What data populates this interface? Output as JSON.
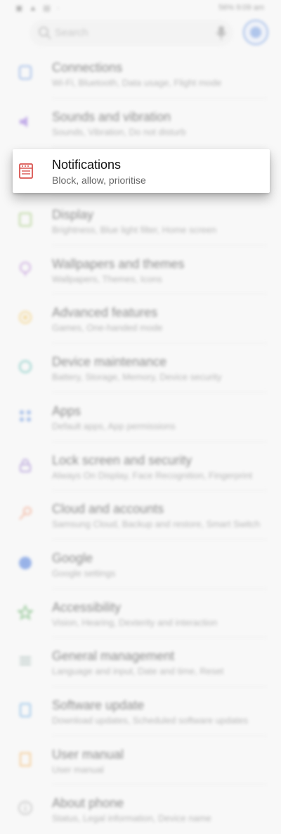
{
  "status_bar": {
    "left_icons": "▣ ▲ ▤ ·",
    "battery": "56%",
    "time": "9:09 am"
  },
  "search": {
    "placeholder": "Search"
  },
  "colors": {
    "accent": "#4a7fd8",
    "highlight_icon": "#d9534f"
  },
  "settings_items": [
    {
      "title": "Connections",
      "subtitle": "Wi-Fi, Bluetooth, Data usage, Flight mode",
      "icon": "connections-icon",
      "color": "#4a7fd8"
    },
    {
      "title": "Sounds and vibration",
      "subtitle": "Sounds, Vibration, Do not disturb",
      "icon": "sound-icon",
      "color": "#8b5fd8"
    },
    {
      "title": "Notifications",
      "subtitle": "Block, allow, prioritise",
      "icon": "notifications-icon",
      "color": "#d9534f"
    },
    {
      "title": "Display",
      "subtitle": "Brightness, Blue light filter, Home screen",
      "icon": "display-icon",
      "color": "#7cb342"
    },
    {
      "title": "Wallpapers and themes",
      "subtitle": "Wallpapers, Themes, Icons",
      "icon": "wallpaper-icon",
      "color": "#a05fc8"
    },
    {
      "title": "Advanced features",
      "subtitle": "Games, One-handed mode",
      "icon": "advanced-features-icon",
      "color": "#f0b429"
    },
    {
      "title": "Device maintenance",
      "subtitle": "Battery, Storage, Memory, Device security",
      "icon": "device-maintenance-icon",
      "color": "#26a69a"
    },
    {
      "title": "Apps",
      "subtitle": "Default apps, App permissions",
      "icon": "apps-icon",
      "color": "#4a7fd8"
    },
    {
      "title": "Lock screen and security",
      "subtitle": "Always On Display, Face Recognition, Fingerprint",
      "icon": "lock-icon",
      "color": "#7e57c2"
    },
    {
      "title": "Cloud and accounts",
      "subtitle": "Samsung Cloud, Backup and restore, Smart Switch",
      "icon": "cloud-key-icon",
      "color": "#ef7c52"
    },
    {
      "title": "Google",
      "subtitle": "Google settings",
      "icon": "google-icon",
      "color": "#3b6fd8"
    },
    {
      "title": "Accessibility",
      "subtitle": "Vision, Hearing, Dexterity and interaction",
      "icon": "accessibility-icon",
      "color": "#43a047"
    },
    {
      "title": "General management",
      "subtitle": "Language and input, Date and time, Reset",
      "icon": "general-management-icon",
      "color": "#6d8f8a"
    },
    {
      "title": "Software update",
      "subtitle": "Download updates, Scheduled software updates",
      "icon": "software-update-icon",
      "color": "#3b8fd8"
    },
    {
      "title": "User manual",
      "subtitle": "User manual",
      "icon": "user-manual-icon",
      "color": "#f09a29"
    },
    {
      "title": "About phone",
      "subtitle": "Status, Legal information, Device name",
      "icon": "info-icon",
      "color": "#9e9e9e"
    }
  ]
}
